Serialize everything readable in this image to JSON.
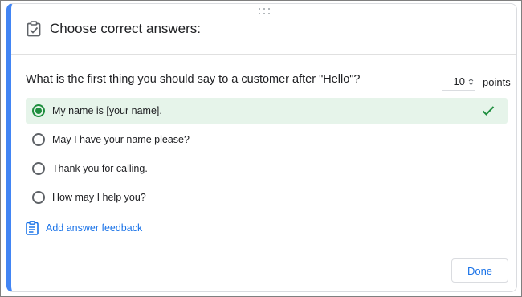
{
  "header": {
    "title": "Choose correct answers:",
    "icon": "clipboard-check-icon"
  },
  "question": {
    "text": "What is the first thing you should say to a customer after \"Hello\"?",
    "points_value": "10",
    "points_label": "points"
  },
  "options": [
    {
      "label": "My name is [your name].",
      "selected": true,
      "correct": true
    },
    {
      "label": "May I have your name please?",
      "selected": false,
      "correct": false
    },
    {
      "label": "Thank you for calling.",
      "selected": false,
      "correct": false
    },
    {
      "label": "How may I help you?",
      "selected": false,
      "correct": false
    }
  ],
  "feedback": {
    "label": "Add answer feedback",
    "icon": "feedback-icon"
  },
  "footer": {
    "done_label": "Done"
  },
  "colors": {
    "accent": "#4285f4",
    "link": "#1a73e8",
    "correct_green": "#1e8e3e",
    "correct_background": "#e6f4ea"
  }
}
